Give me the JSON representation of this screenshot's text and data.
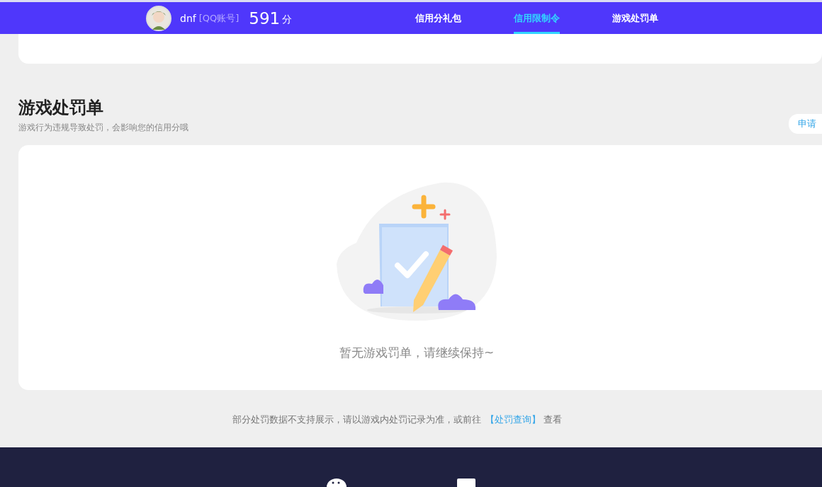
{
  "header": {
    "user": {
      "name": "dnf",
      "account_type": "[QQ账号]",
      "score": "591",
      "score_unit": "分"
    },
    "tabs": [
      {
        "label": "信用分礼包",
        "selected": false
      },
      {
        "label": "信用限制令",
        "selected": true
      },
      {
        "label": "游戏处罚单",
        "selected": false
      }
    ]
  },
  "section": {
    "title": "游戏处罚单",
    "subtitle": "游戏行为违规导致处罚，会影响您的信用分哦",
    "action_button": "申请"
  },
  "empty_state": {
    "message": "暂无游戏罚单，请继续保持~"
  },
  "note": {
    "text": "部分处罚数据不支持展示，请以游戏内处罚记录为准，或前往",
    "link": "【处罚查询】",
    "suffix": "查看"
  }
}
